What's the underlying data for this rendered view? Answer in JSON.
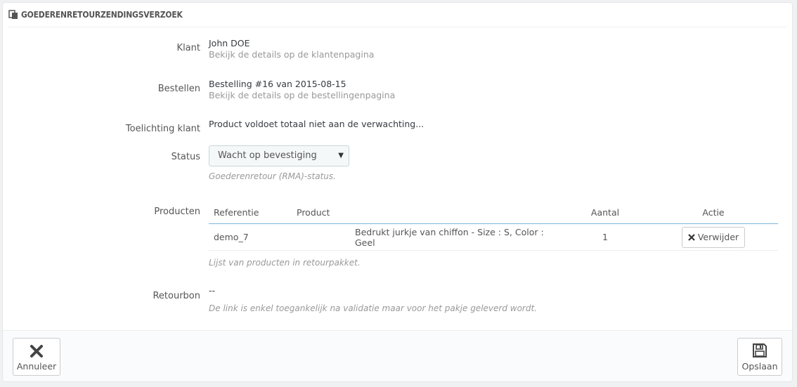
{
  "header": {
    "title": "GOEDERENRETOURZENDINGSVERZOEK",
    "icon": "copy-icon"
  },
  "customer": {
    "label": "Klant",
    "name": "John DOE",
    "link": "Bekijk de details op de klantenpagina"
  },
  "order": {
    "label": "Bestellen",
    "value": "Bestelling #16 van 2015-08-15",
    "link": "Bekijk de details op de bestellingenpagina"
  },
  "comment": {
    "label": "Toelichting klant",
    "value": "Product voldoet totaal niet aan de verwachting..."
  },
  "status": {
    "label": "Status",
    "selected": "Wacht op bevestiging",
    "help": "Goederenretour (RMA)-status."
  },
  "products": {
    "label": "Producten",
    "columns": {
      "reference": "Referentie",
      "product": "Product",
      "quantity": "Aantal",
      "action": "Actie"
    },
    "rows": [
      {
        "reference": "demo_7",
        "product": "Bedrukt jurkje van chiffon - Size : S, Color : Geel",
        "quantity": "1",
        "action": "Verwijder"
      }
    ],
    "help": "Lijst van producten in retourpakket."
  },
  "voucher": {
    "label": "Retourbon",
    "value": "--",
    "help": "De link is enkel toegankelijk na validatie maar voor het pakje geleverd wordt."
  },
  "footer": {
    "cancel_label": "Annuleer",
    "save_label": "Opslaan"
  },
  "colors": {
    "table_header_border": "#7cb5d9",
    "page_bg": "#eff1f2"
  }
}
